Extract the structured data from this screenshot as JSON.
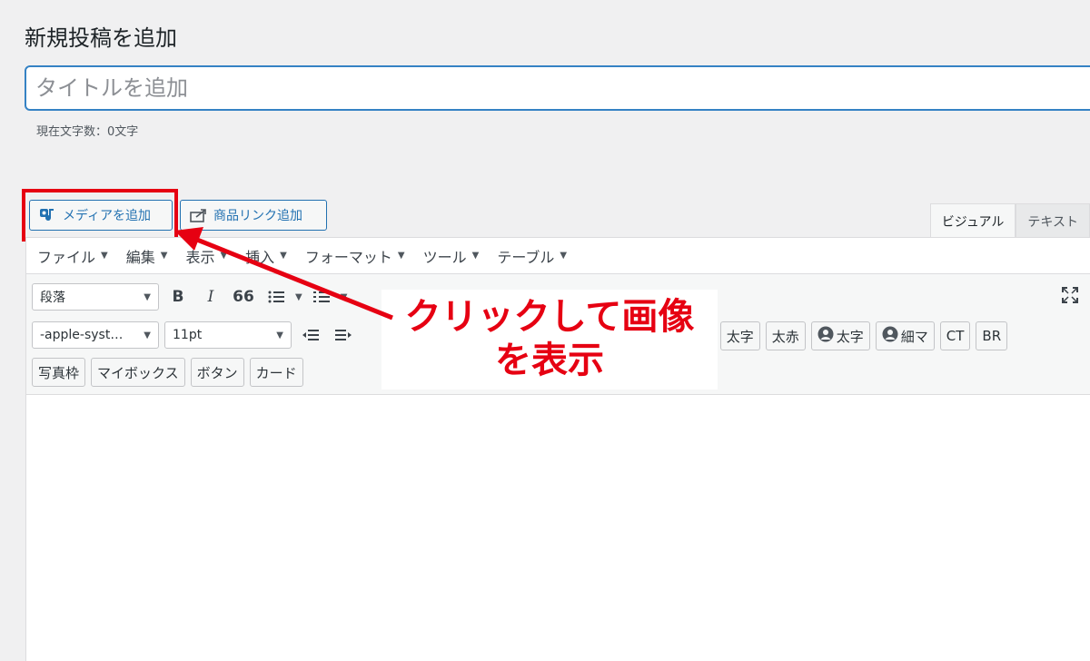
{
  "page": {
    "title": "新規投稿を追加"
  },
  "title_field": {
    "placeholder": "タイトルを追加",
    "value": ""
  },
  "char_count": "現在文字数：0文字",
  "buttons": {
    "add_media": "メディアを追加",
    "product_link": "商品リンク追加"
  },
  "mode_tabs": [
    "ビジュアル",
    "テキスト"
  ],
  "menubar": [
    "ファイル",
    "編集",
    "表示",
    "挿入",
    "フォーマット",
    "ツール",
    "テーブル"
  ],
  "toolbar": {
    "format_select": "段落",
    "font_family_select": "-apple-syst…",
    "font_size_select": "11pt",
    "bold": "B",
    "italic": "I",
    "quote": "66",
    "quicktags_row2": [
      "太字",
      "太赤",
      "太字",
      "細マ",
      "CT",
      "BR"
    ],
    "quicktags_row3": [
      "写真枠",
      "マイボックス",
      "ボタン",
      "カード"
    ]
  },
  "annotation": {
    "line1": "クリックして画像",
    "line2": "を表示"
  },
  "colors": {
    "accent": "#2271b1",
    "annotation_red": "#e60012",
    "focus_blue": "#3582c4"
  }
}
